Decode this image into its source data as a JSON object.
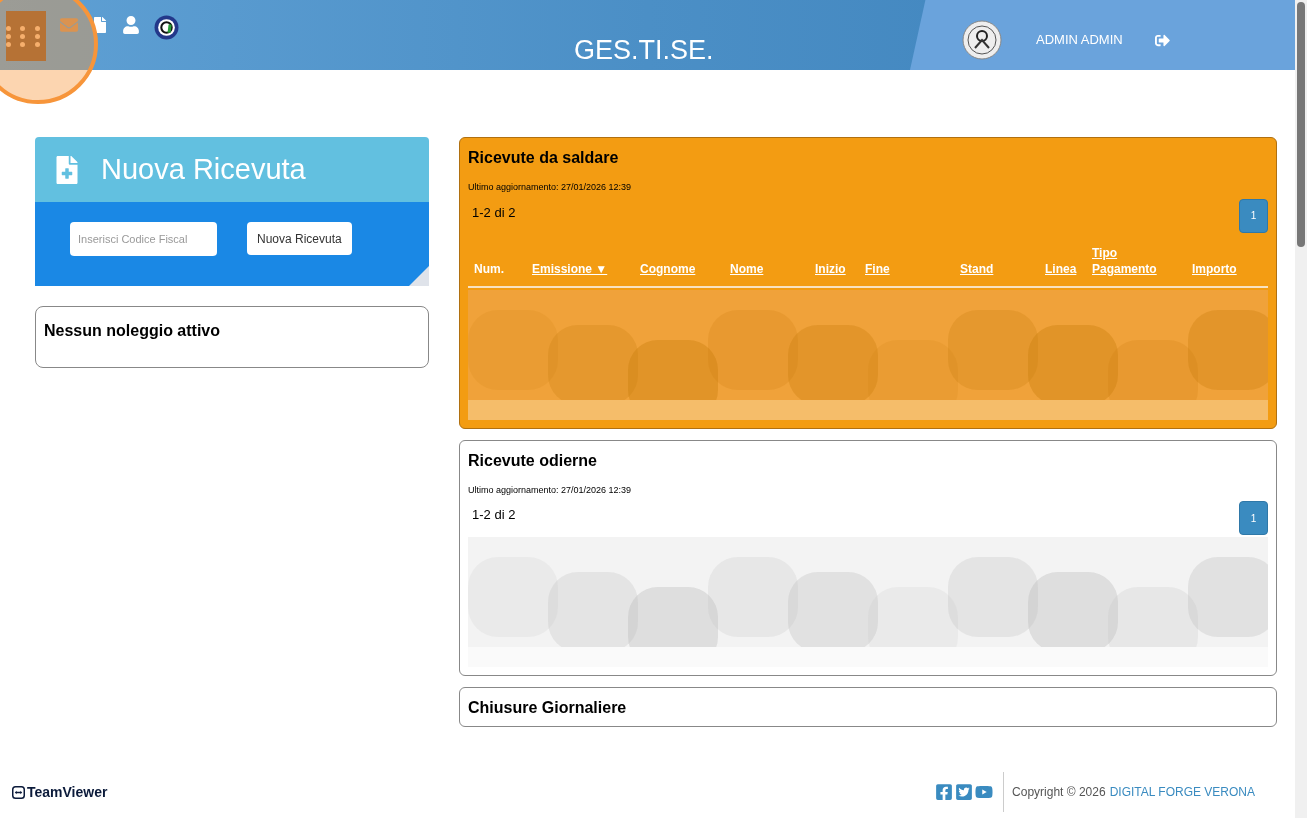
{
  "header": {
    "title": "GES.TI.SE.",
    "user": "ADMIN ADMIN"
  },
  "new_receipt": {
    "title": "Nuova Ricevuta",
    "field": {
      "placeholder": "Inserisci Codice Fiscal"
    },
    "button": "Nuova Ricevuta"
  },
  "rentals": {
    "title": "Nessun noleggio attivo"
  },
  "panels": [
    {
      "title": "Ricevute da saldare",
      "kind": "highlight",
      "updated": "Ultimo aggiornamento: 27/01/2026 12:39",
      "count": "1-2 di 2",
      "pages": [
        {
          "label": "1",
          "selected": true
        }
      ],
      "columns": [
        "Num.",
        "Emissione ▼",
        "Cognome",
        "Nome",
        "Inizio",
        "Fine",
        "Stand",
        "Linea",
        "Tipo Pagamento",
        "Importo"
      ]
    },
    {
      "title": "Ricevute odierne",
      "kind": "plain",
      "updated": "Ultimo aggiornamento: 27/01/2026 12:39",
      "count": "1-2 di 2",
      "pages": [
        {
          "label": "1",
          "selected": true
        }
      ]
    },
    {
      "title": "Chiusure Giornaliere",
      "kind": "plain"
    }
  ],
  "footer": {
    "recorder": "TeamViewer",
    "copyright": "Copyright © 2026",
    "company": "DIGITAL FORGE VERONA"
  }
}
